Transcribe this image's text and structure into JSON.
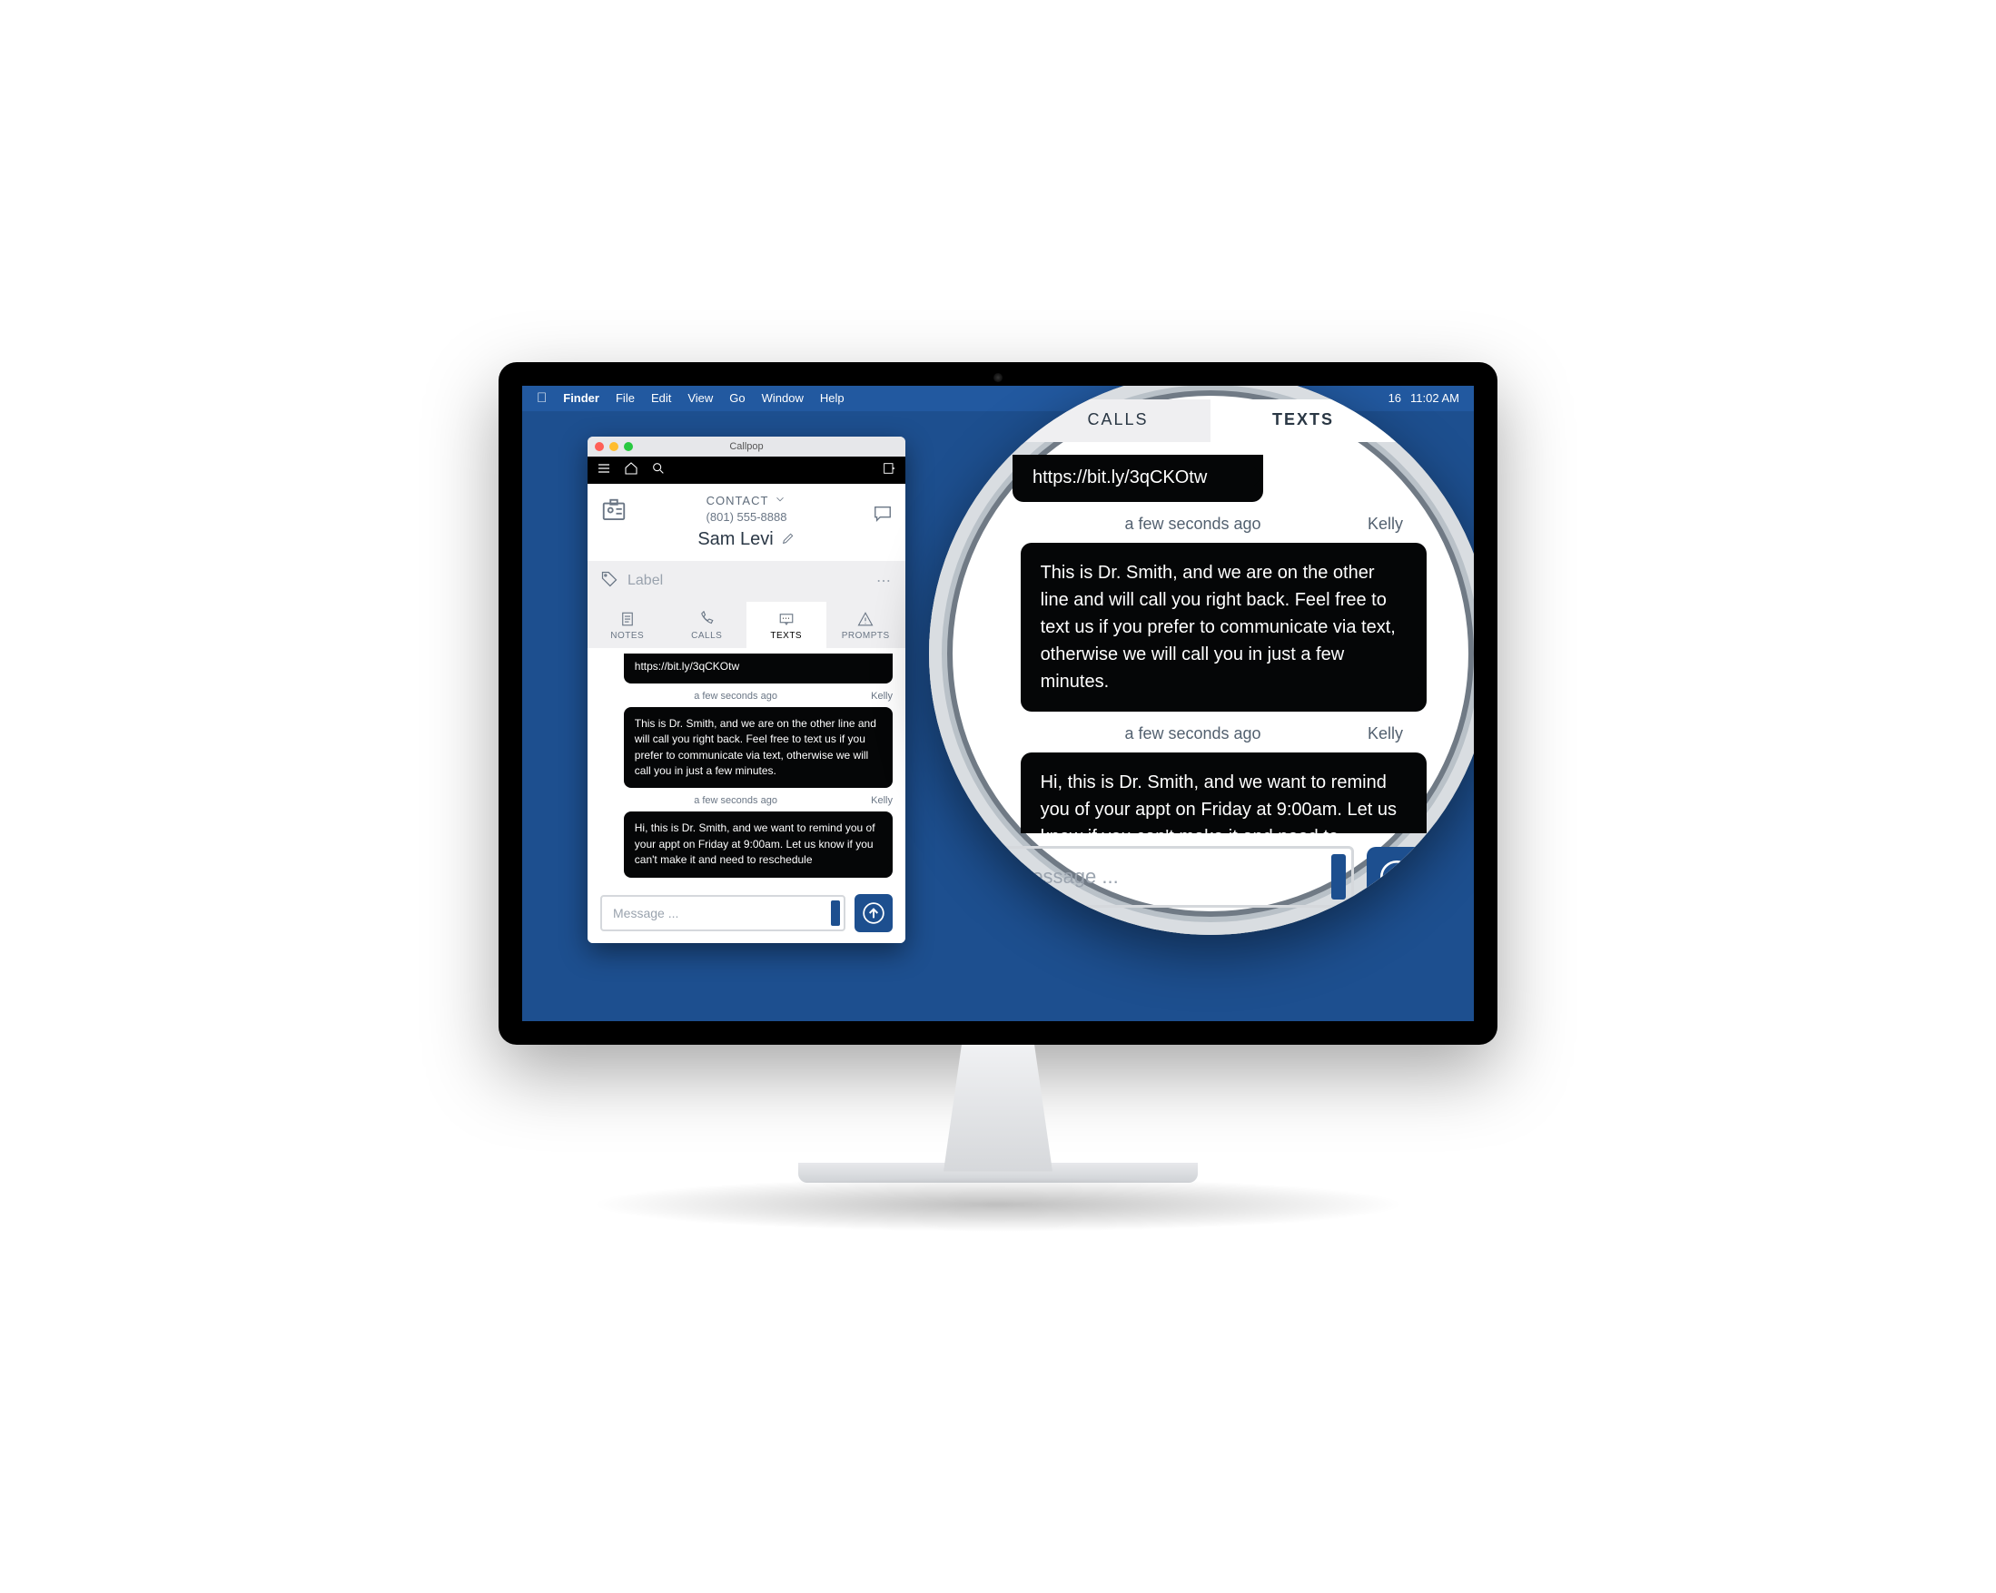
{
  "menubar": {
    "app": "Finder",
    "items": [
      "File",
      "Edit",
      "View",
      "Go",
      "Window",
      "Help"
    ],
    "right_date": "16",
    "right_time": "11:02 AM"
  },
  "callpop": {
    "title": "Callpop",
    "contact_label": "CONTACT",
    "phone": "(801) 555-8888",
    "name": "Sam Levi",
    "label_placeholder": "Label",
    "tabs": [
      "NOTES",
      "CALLS",
      "TEXTS",
      "PROMPTS"
    ],
    "active_tab_index": 2,
    "msg_partial": "https://bit.ly/3qCKOtw",
    "meta1_time": "a few seconds ago",
    "meta1_who": "Kelly",
    "msg1": "This is Dr. Smith, and we are on the other line and will call you right back. Feel free to text us if you prefer to communicate via text, otherwise we will call you in just a few minutes.",
    "meta2_time": "a few seconds ago",
    "meta2_who": "Kelly",
    "msg2": "Hi, this is Dr. Smith, and we want to remind you of your appt on Friday at 9:00am. Let us know if you can't make it and need to reschedule",
    "compose_placeholder": "Message ..."
  },
  "magnifier": {
    "tabs": [
      "CALLS",
      "TEXTS"
    ],
    "active_tab_index": 1,
    "partial": "https://bit.ly/3qCKOtw",
    "meta1_time": "a few seconds ago",
    "meta1_who": "Kelly",
    "msg1": "This is Dr. Smith, and we are on the other line and will call you right back. Feel free to text us if you prefer to communicate via text, otherwise we will call you in just a few minutes.",
    "meta2_time": "a few seconds ago",
    "meta2_who": "Kelly",
    "msg2": "Hi, this is Dr. Smith, and we want to remind you of your appt on Friday at 9:00am. Let us know if you can't make it and need to reschedule",
    "compose_placeholder": "Message ..."
  }
}
